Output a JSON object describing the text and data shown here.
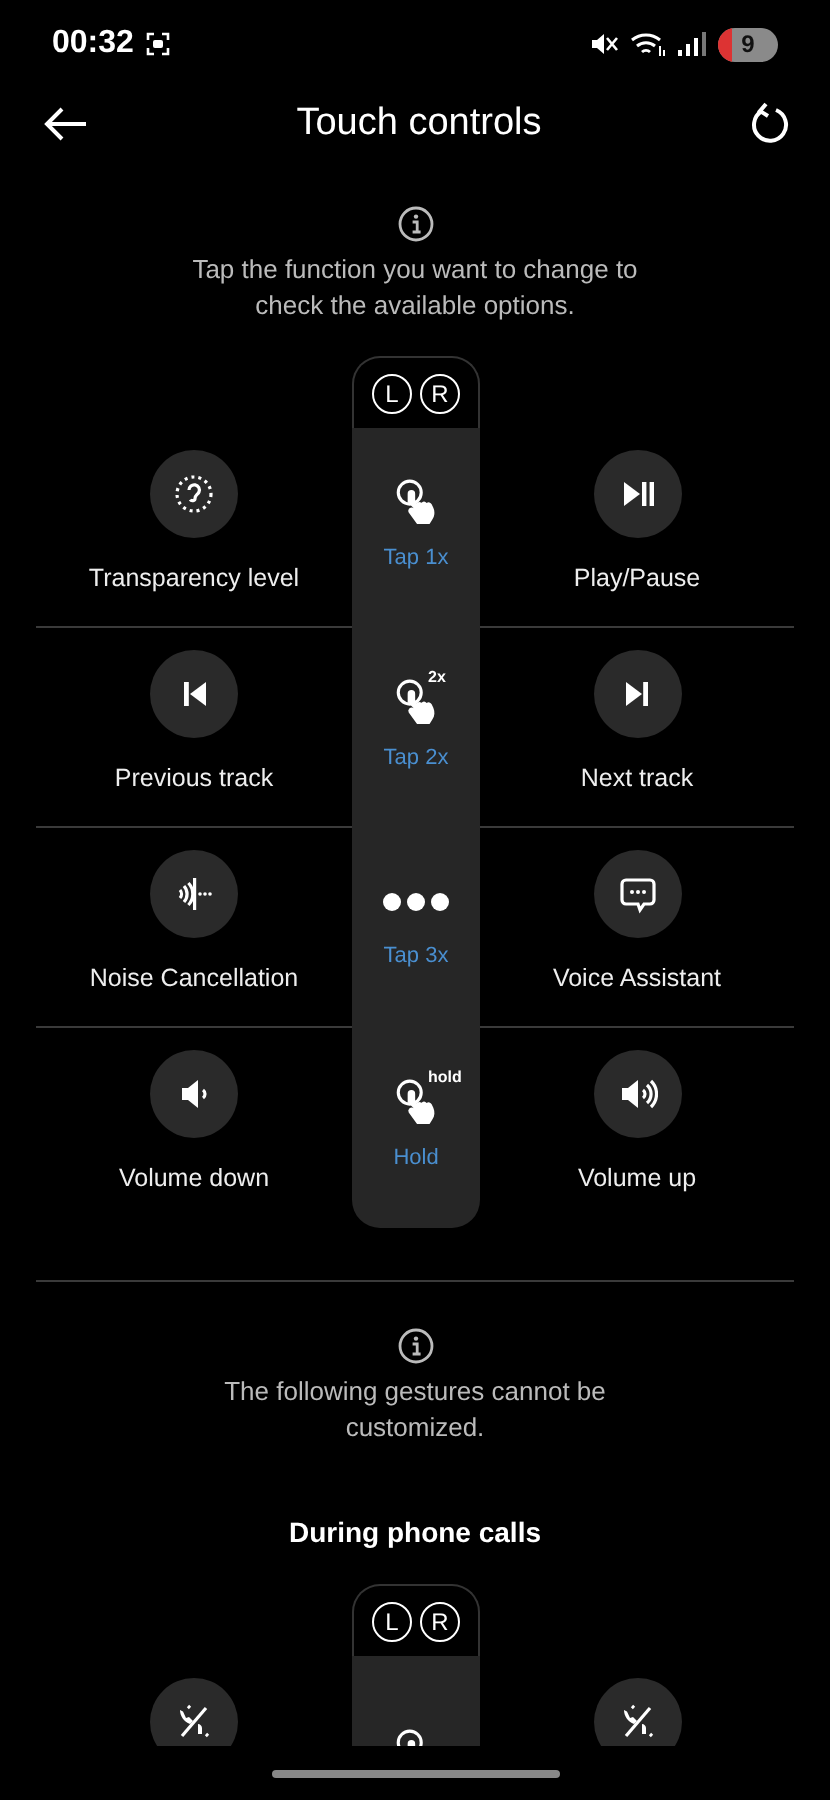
{
  "status_bar": {
    "time": "00:32",
    "battery": "9"
  },
  "header": {
    "title": "Touch controls"
  },
  "sections": [
    {
      "info": "Tap the function you want to change to check the available options.",
      "earbuds": [
        "L",
        "R"
      ],
      "rows": [
        {
          "left": {
            "kind": "transparency",
            "label": "Transparency level"
          },
          "gesture": {
            "kind": "tap",
            "label": "Tap 1x"
          },
          "right": {
            "kind": "play-pause",
            "label": "Play/Pause"
          }
        },
        {
          "left": {
            "kind": "previous",
            "label": "Previous track"
          },
          "gesture": {
            "kind": "tap",
            "badge": "2x",
            "label": "Tap 2x"
          },
          "right": {
            "kind": "next",
            "label": "Next track"
          }
        },
        {
          "left": {
            "kind": "noise",
            "label": "Noise Cancellation"
          },
          "gesture": {
            "kind": "dots",
            "label": "Tap 3x"
          },
          "right": {
            "kind": "assistant",
            "label": "Voice Assistant"
          }
        },
        {
          "left": {
            "kind": "volume-down",
            "label": "Volume down"
          },
          "gesture": {
            "kind": "tap",
            "badge": "hold",
            "label": "Hold"
          },
          "right": {
            "kind": "volume-up",
            "label": "Volume up"
          }
        }
      ]
    },
    {
      "info": "The following gestures cannot be customized.",
      "title": "During phone calls",
      "earbuds": [
        "L",
        "R"
      ],
      "rows": [
        {
          "left": {
            "kind": "call"
          },
          "gesture": {
            "kind": "tap"
          },
          "right": {
            "kind": "call"
          }
        }
      ]
    }
  ]
}
